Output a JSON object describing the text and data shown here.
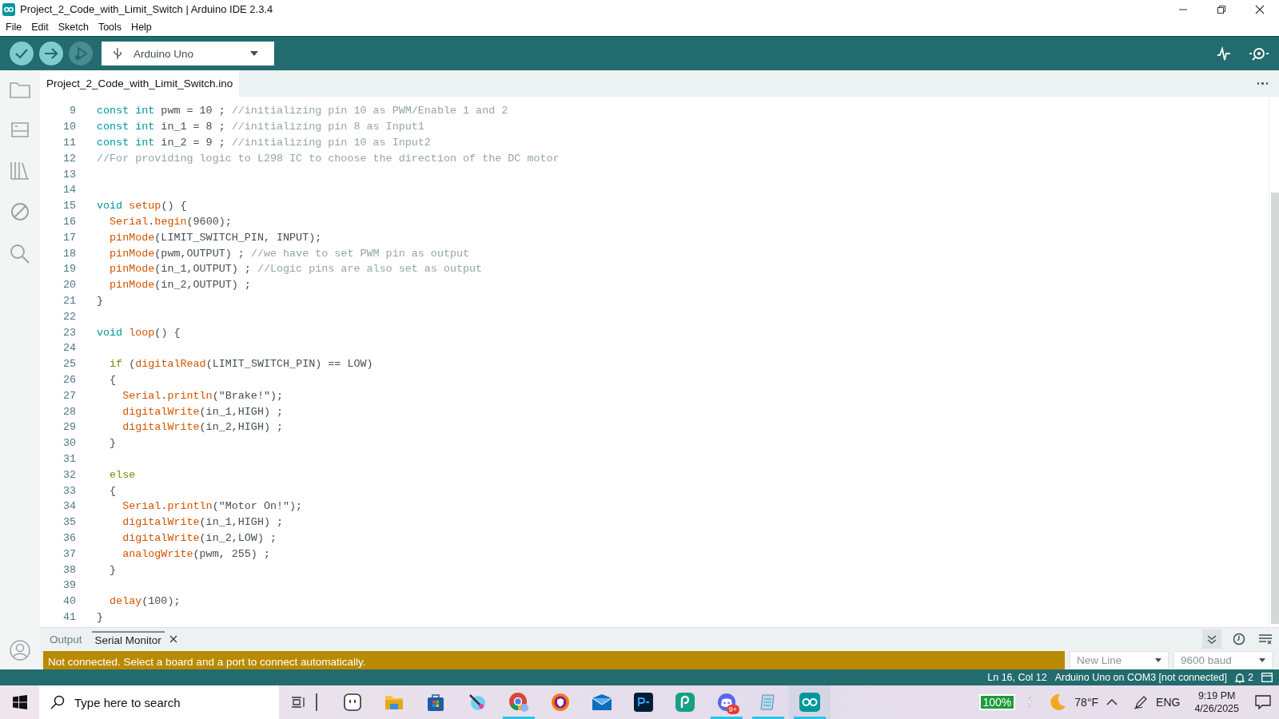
{
  "window": {
    "title": "Project_2_Code_with_Limit_Switch | Arduino IDE 2.3.4"
  },
  "menu": [
    "File",
    "Edit",
    "Sketch",
    "Tools",
    "Help"
  ],
  "toolbar": {
    "debug_disabled": true,
    "board": "Arduino Uno"
  },
  "file_tabs": [
    {
      "label": "Project_2_Code_with_Limit_Switch.ino",
      "selected": true
    }
  ],
  "editor": {
    "lines": [
      {
        "number": "9",
        "tokens": [
          {
            "kind": "type",
            "text": "const int"
          },
          {
            "kind": "plain",
            "text": " pwm = 10 ; "
          },
          {
            "kind": "comment",
            "text": "//initializing pin 10 as PWM/Enable 1 and 2"
          }
        ]
      },
      {
        "number": "10",
        "tokens": [
          {
            "kind": "type",
            "text": "const int"
          },
          {
            "kind": "plain",
            "text": " in_1 = 8 ; "
          },
          {
            "kind": "comment",
            "text": "//initializing pin 8 as Input1"
          }
        ]
      },
      {
        "number": "11",
        "tokens": [
          {
            "kind": "type",
            "text": "const int"
          },
          {
            "kind": "plain",
            "text": " in_2 = 9 ; "
          },
          {
            "kind": "comment",
            "text": "//initializing pin 10 as Input2"
          }
        ]
      },
      {
        "number": "12",
        "tokens": [
          {
            "kind": "comment",
            "text": "//For providing logic to L298 IC to choose the direction of the DC motor"
          }
        ]
      },
      {
        "number": "13"
      },
      {
        "number": "14"
      },
      {
        "number": "15",
        "tokens": [
          {
            "kind": "type",
            "text": "void "
          },
          {
            "kind": "func",
            "text": "setup"
          },
          {
            "kind": "plain",
            "text": "() {"
          }
        ]
      },
      {
        "number": "16",
        "tokens": [
          {
            "kind": "func",
            "text": "  Serial"
          },
          {
            "kind": "plain",
            "text": "."
          },
          {
            "kind": "func",
            "text": "begin"
          },
          {
            "kind": "plain",
            "text": "(9600);"
          }
        ]
      },
      {
        "number": "17",
        "tokens": [
          {
            "kind": "func",
            "text": "  pinMode"
          },
          {
            "kind": "plain",
            "text": "(LIMIT_SWITCH_PIN, INPUT);"
          }
        ]
      },
      {
        "number": "18",
        "tokens": [
          {
            "kind": "func",
            "text": "  pinMode"
          },
          {
            "kind": "plain",
            "text": "(pwm,OUTPUT) ; "
          },
          {
            "kind": "comment",
            "text": "//we have to set PWM pin as output"
          }
        ]
      },
      {
        "number": "19",
        "tokens": [
          {
            "kind": "func",
            "text": "  pinMode"
          },
          {
            "kind": "plain",
            "text": "(in_1,OUTPUT) ; "
          },
          {
            "kind": "comment",
            "text": "//Logic pins are also set as output"
          }
        ]
      },
      {
        "number": "20",
        "tokens": [
          {
            "kind": "func",
            "text": "  pinMode"
          },
          {
            "kind": "plain",
            "text": "(in_2,OUTPUT) ;"
          }
        ]
      },
      {
        "number": "21",
        "tokens": [
          {
            "kind": "plain",
            "text": "}"
          }
        ]
      },
      {
        "number": "22"
      },
      {
        "number": "23",
        "tokens": [
          {
            "kind": "type",
            "text": "void "
          },
          {
            "kind": "func",
            "text": "loop"
          },
          {
            "kind": "plain",
            "text": "() {"
          }
        ]
      },
      {
        "number": "24"
      },
      {
        "number": "25",
        "tokens": [
          {
            "kind": "control",
            "text": "  if"
          },
          {
            "kind": "plain",
            "text": " ("
          },
          {
            "kind": "func",
            "text": "digitalRead"
          },
          {
            "kind": "plain",
            "text": "(LIMIT_SWITCH_PIN) == LOW)"
          }
        ]
      },
      {
        "number": "26",
        "tokens": [
          {
            "kind": "plain",
            "text": "  {"
          }
        ]
      },
      {
        "number": "27",
        "tokens": [
          {
            "kind": "func",
            "text": "    Serial"
          },
          {
            "kind": "plain",
            "text": "."
          },
          {
            "kind": "func",
            "text": "println"
          },
          {
            "kind": "plain",
            "text": "(\"Brake!\");"
          }
        ]
      },
      {
        "number": "28",
        "tokens": [
          {
            "kind": "func",
            "text": "    digitalWrite"
          },
          {
            "kind": "plain",
            "text": "(in_1,HIGH) ;"
          }
        ]
      },
      {
        "number": "29",
        "tokens": [
          {
            "kind": "func",
            "text": "    digitalWrite"
          },
          {
            "kind": "plain",
            "text": "(in_2,HIGH) ;"
          }
        ]
      },
      {
        "number": "30",
        "tokens": [
          {
            "kind": "plain",
            "text": "  }"
          }
        ]
      },
      {
        "number": "31"
      },
      {
        "number": "32",
        "tokens": [
          {
            "kind": "control",
            "text": "  else"
          }
        ]
      },
      {
        "number": "33",
        "tokens": [
          {
            "kind": "plain",
            "text": "  {"
          }
        ]
      },
      {
        "number": "34",
        "tokens": [
          {
            "kind": "func",
            "text": "    Serial"
          },
          {
            "kind": "plain",
            "text": "."
          },
          {
            "kind": "func",
            "text": "println"
          },
          {
            "kind": "plain",
            "text": "(\"Motor On!\");"
          }
        ]
      },
      {
        "number": "35",
        "tokens": [
          {
            "kind": "func",
            "text": "    digitalWrite"
          },
          {
            "kind": "plain",
            "text": "(in_1,HIGH) ;"
          }
        ]
      },
      {
        "number": "36",
        "tokens": [
          {
            "kind": "func",
            "text": "    digitalWrite"
          },
          {
            "kind": "plain",
            "text": "(in_2,LOW) ;"
          }
        ]
      },
      {
        "number": "37",
        "tokens": [
          {
            "kind": "func",
            "text": "    analogWrite"
          },
          {
            "kind": "plain",
            "text": "(pwm, 255) ;"
          }
        ]
      },
      {
        "number": "38",
        "tokens": [
          {
            "kind": "plain",
            "text": "  }"
          }
        ]
      },
      {
        "number": "39"
      },
      {
        "number": "40",
        "tokens": [
          {
            "kind": "func",
            "text": "  delay"
          },
          {
            "kind": "plain",
            "text": "(100);"
          }
        ]
      },
      {
        "number": "41",
        "tokens": [
          {
            "kind": "plain",
            "text": "}"
          }
        ]
      }
    ]
  },
  "panel": {
    "tabs": [
      {
        "label": "Output",
        "selected": false,
        "closable": false
      },
      {
        "label": "Serial Monitor",
        "selected": true,
        "closable": true
      }
    ],
    "message": "Not connected. Select a board and a port to connect automatically.",
    "line_ending": "New Line",
    "baud": "9600 baud"
  },
  "status_bar": {
    "position": "Ln 16, Col 12",
    "board": "Arduino Uno on COM3 [not connected]",
    "notifications": "2"
  },
  "taskbar": {
    "search_placeholder": "Type here to search",
    "apps": [
      {
        "kind": "tablet",
        "running": false,
        "active": false
      },
      {
        "kind": "folder",
        "running": false,
        "active": false
      },
      {
        "kind": "store",
        "running": false,
        "active": false
      },
      {
        "kind": "paint",
        "running": false,
        "active": false
      },
      {
        "kind": "browser",
        "running": true,
        "active": false
      },
      {
        "kind": "shield",
        "running": false,
        "active": false
      },
      {
        "kind": "mail",
        "running": false,
        "active": false
      },
      {
        "kind": "ps",
        "running": false,
        "active": false
      },
      {
        "kind": "p",
        "running": false,
        "active": false
      },
      {
        "kind": "chat",
        "running": true,
        "active": false,
        "badge": "9+"
      },
      {
        "kind": "notepad",
        "running": true,
        "active": false
      },
      {
        "kind": "arduino",
        "running": true,
        "active": true
      }
    ],
    "battery": "100%",
    "temperature": "78°F",
    "language": "ENG",
    "time": "9:19 PM",
    "date": "4/26/2025"
  }
}
